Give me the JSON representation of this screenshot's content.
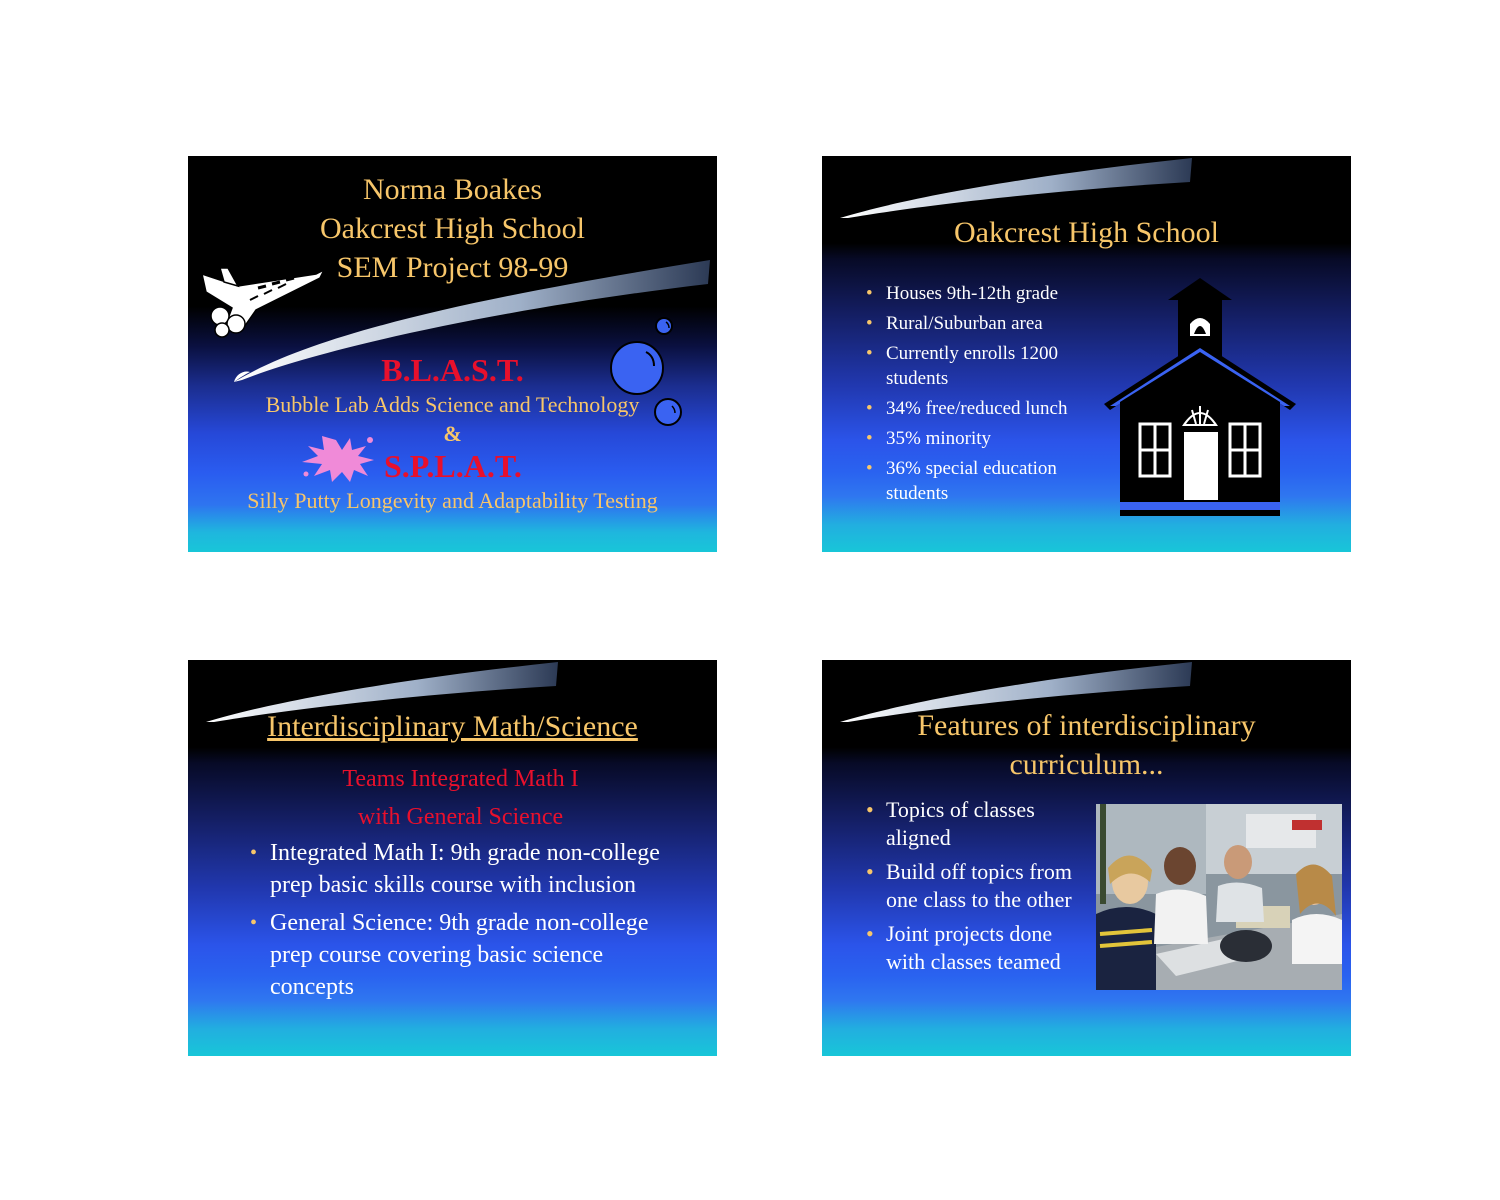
{
  "slide1": {
    "title_line1": "Norma Boakes",
    "title_line2": "Oakcrest High School",
    "title_line3": "SEM Project 98-99",
    "blast": "B.L.A.S.T.",
    "blast_desc": "Bubble Lab Adds Science and Technology",
    "ampersand": "&",
    "splat": "S.P.L.A.T.",
    "splat_desc": "Silly Putty Longevity and Adaptability Testing"
  },
  "slide2": {
    "title": "Oakcrest High School",
    "bullets": [
      "Houses 9th-12th grade",
      "Rural/Suburban area",
      "Currently enrolls 1200 students",
      "34% free/reduced lunch",
      "35% minority",
      "36% special education students"
    ]
  },
  "slide3": {
    "title": "Interdisciplinary Math/Science",
    "subtitle_line1": "Teams Integrated Math I",
    "subtitle_line2": "with General Science",
    "bullets": [
      "Integrated Math I: 9th grade non-college prep basic skills course with inclusion",
      "General Science: 9th grade non-college prep course covering basic science concepts"
    ]
  },
  "slide4": {
    "title_line1": "Features of interdisciplinary",
    "title_line2": "curriculum...",
    "bullets": [
      "Topics of classes aligned",
      "Build off topics from one class to the other",
      "Joint projects done with classes teamed"
    ]
  },
  "bullet_symbol": "•",
  "colors": {
    "title_gold": "#f7c66a",
    "accent_red": "#e8102c",
    "bullet_white": "#ffffff",
    "slide_top": "#000000",
    "slide_blue": "#2a5cf0",
    "slide_bottom_cyan": "#18c6d8"
  }
}
